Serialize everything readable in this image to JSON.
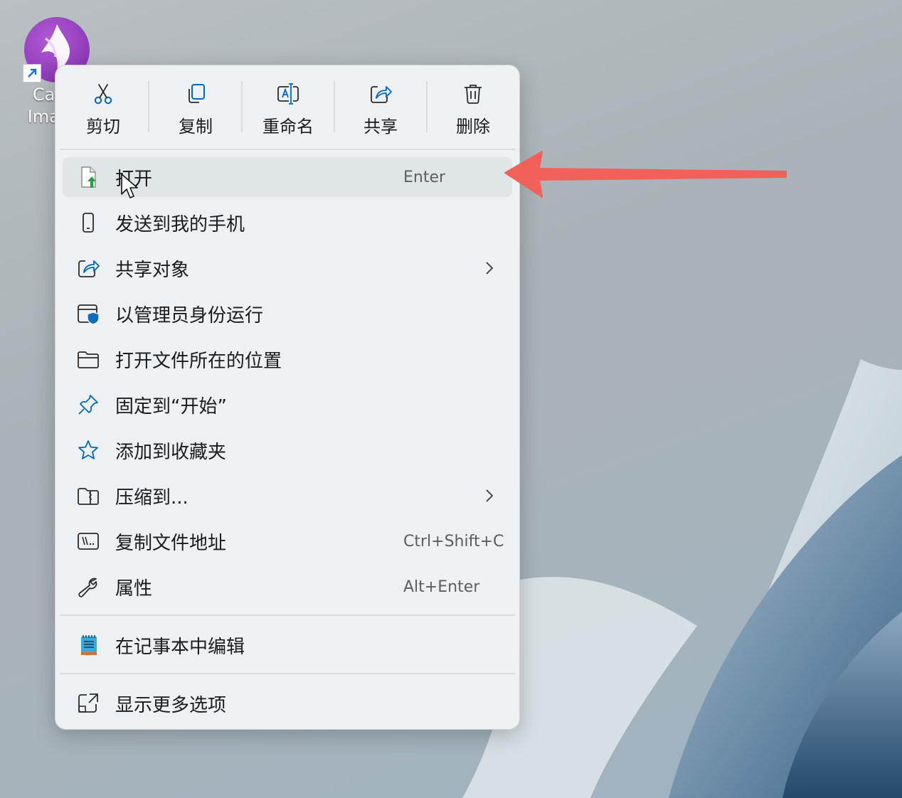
{
  "desktop": {
    "icon_label": "Cae\nImag",
    "icon_name": "purple-bird-logo-icon"
  },
  "menu": {
    "quick_actions": [
      {
        "label": "剪切",
        "icon": "scissors-icon"
      },
      {
        "label": "复制",
        "icon": "copy-icon"
      },
      {
        "label": "重命名",
        "icon": "rename-icon"
      },
      {
        "label": "共享",
        "icon": "share-icon"
      },
      {
        "label": "删除",
        "icon": "trash-icon"
      }
    ],
    "items": [
      {
        "label": "打开",
        "shortcut": "Enter",
        "icon": "open-file-icon",
        "hovered": true
      },
      {
        "label": "发送到我的手机",
        "icon": "phone-icon"
      },
      {
        "label": "共享对象",
        "icon": "share-icon",
        "submenu": true
      },
      {
        "label": "以管理员身份运行",
        "icon": "admin-shield-icon"
      },
      {
        "label": "打开文件所在的位置",
        "icon": "folder-icon"
      },
      {
        "label": "固定到“开始”",
        "icon": "pin-icon"
      },
      {
        "label": "添加到收藏夹",
        "icon": "star-icon"
      },
      {
        "label": "压缩到...",
        "icon": "zip-folder-icon",
        "submenu": true
      },
      {
        "label": "复制文件地址",
        "shortcut": "Ctrl+Shift+C",
        "icon": "copy-path-icon"
      },
      {
        "label": "属性",
        "shortcut": "Alt+Enter",
        "icon": "wrench-icon"
      },
      {
        "label": "在记事本中编辑",
        "icon": "notepad-icon"
      },
      {
        "label": "显示更多选项",
        "icon": "more-options-icon"
      }
    ]
  },
  "colors": {
    "accent": "#0067c0",
    "annotation_arrow": "#f2605a",
    "menu_background": "#eef1f3"
  }
}
